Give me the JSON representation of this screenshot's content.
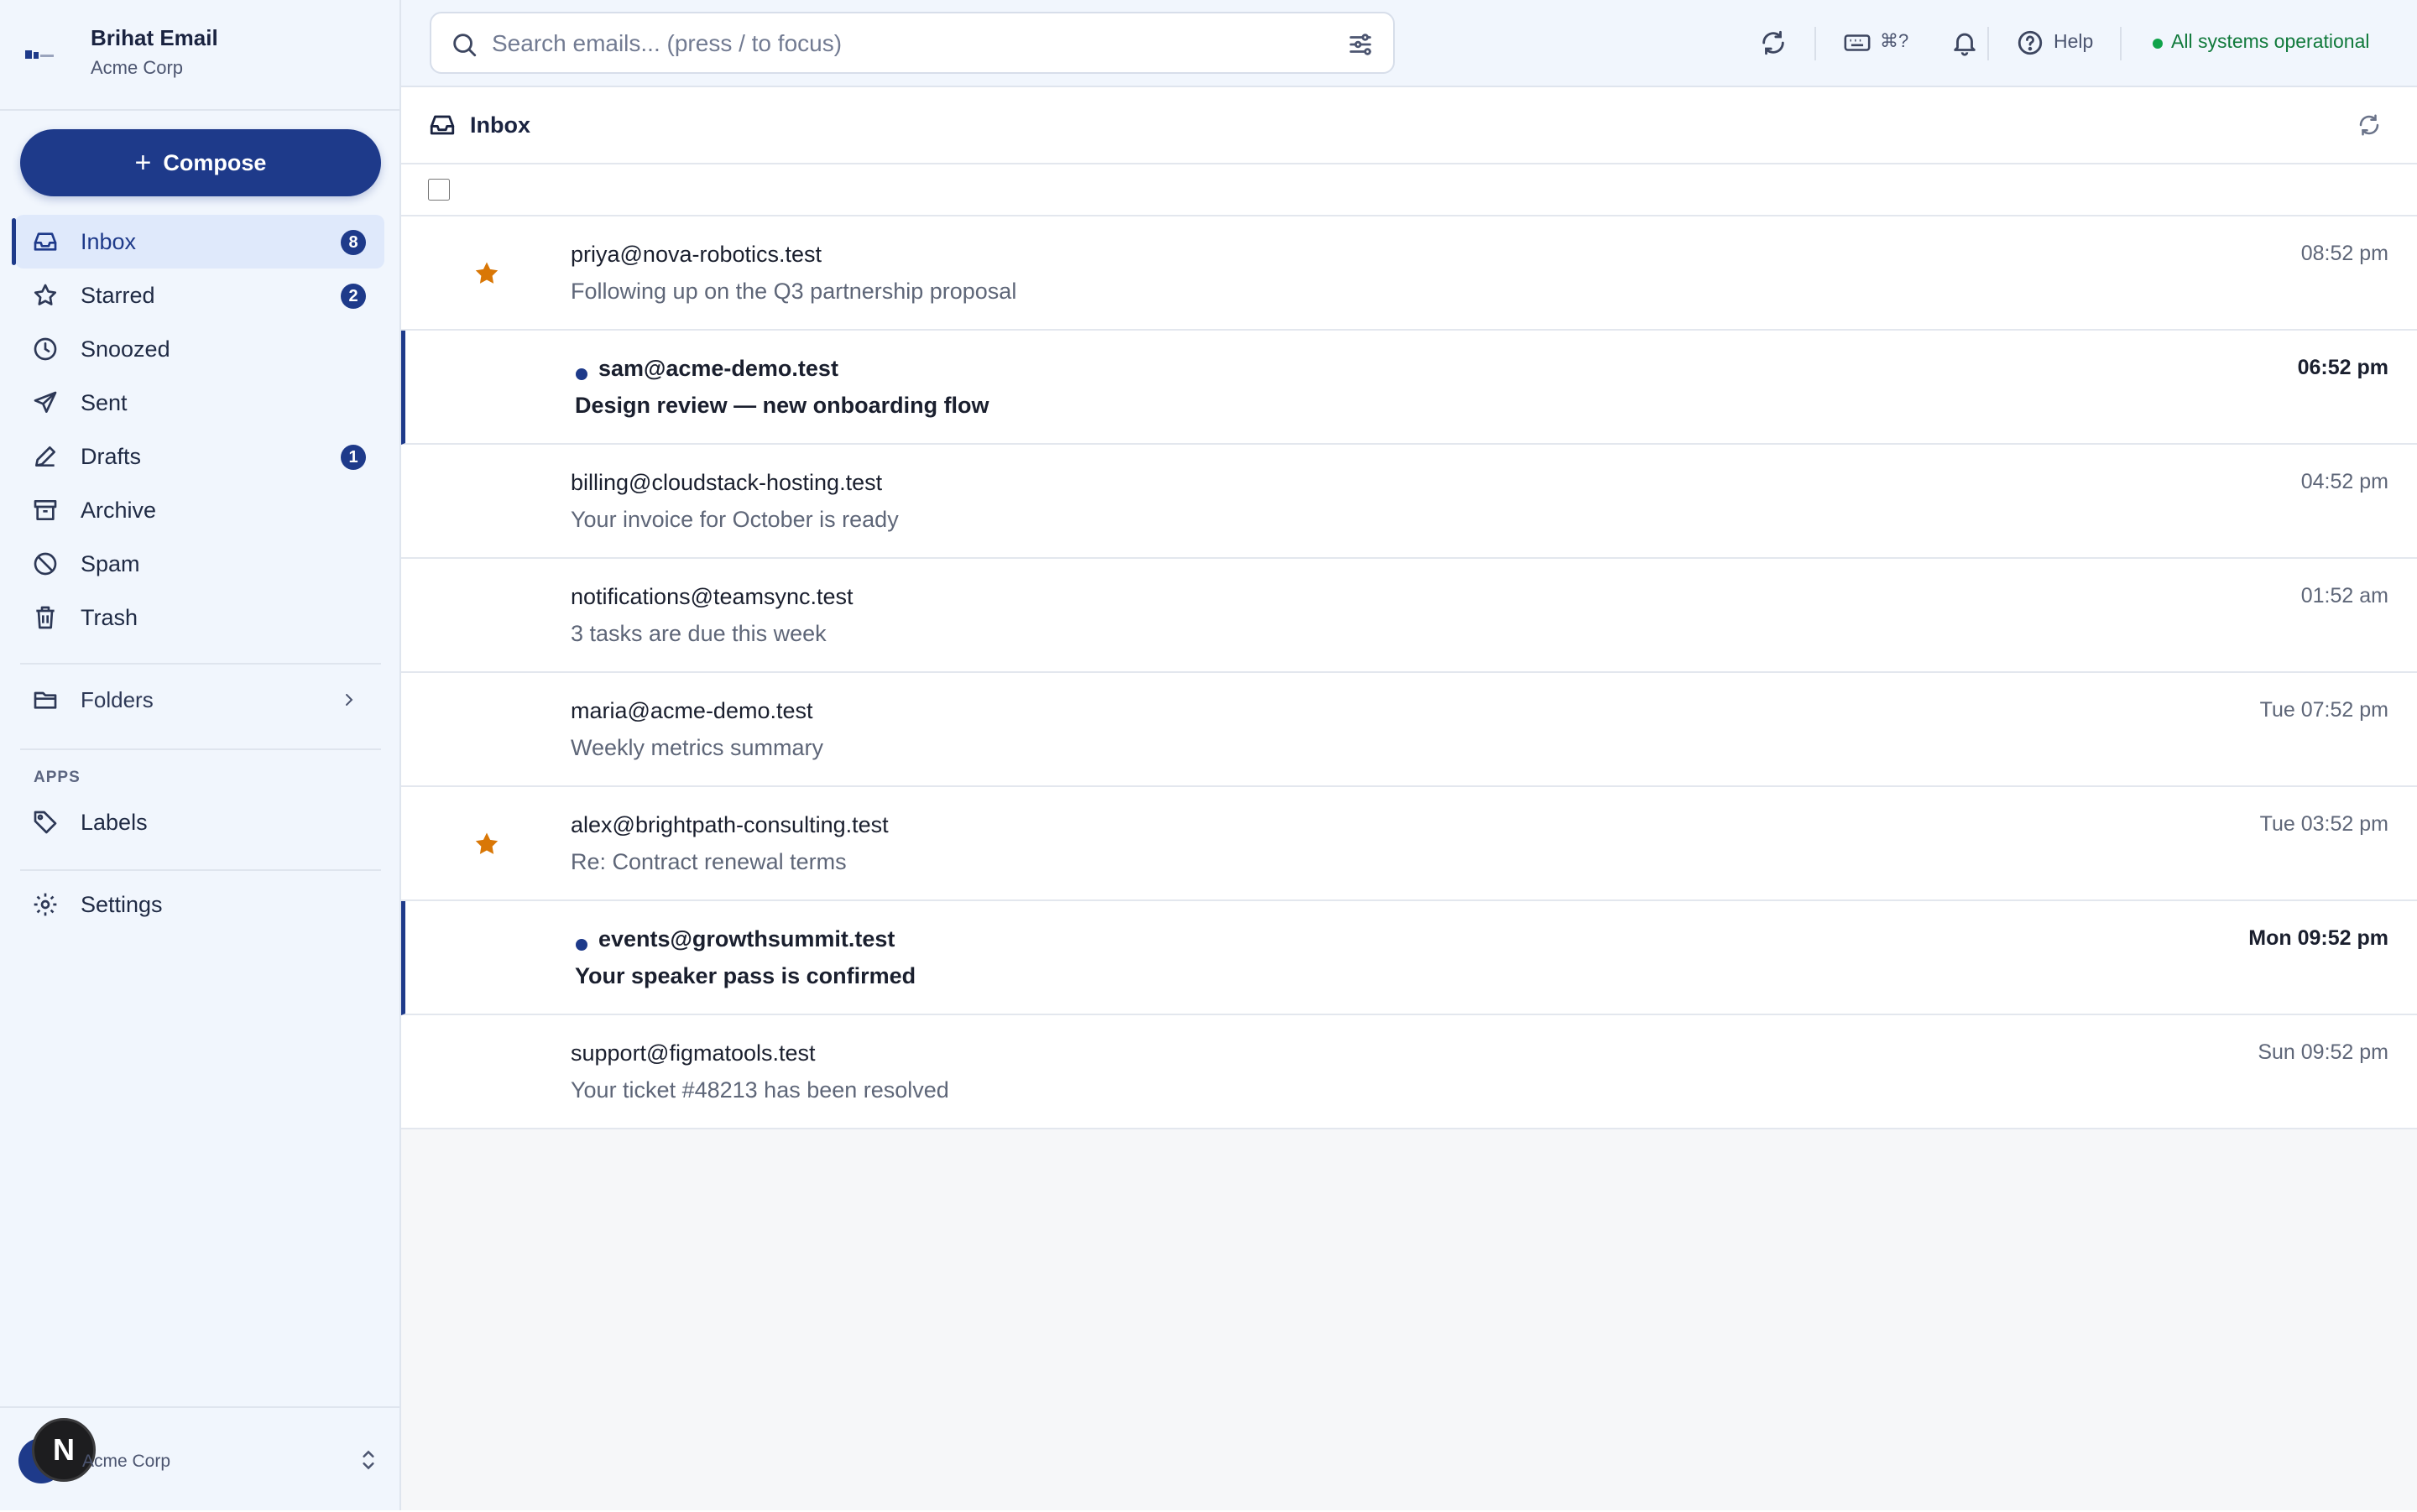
{
  "brand": {
    "title": "Brihat Email",
    "org": "Acme Corp"
  },
  "compose": {
    "label": "Compose"
  },
  "nav": [
    {
      "label": "Inbox",
      "icon": "inbox-icon",
      "badge": "8",
      "active": true
    },
    {
      "label": "Starred",
      "icon": "star-icon",
      "badge": "2"
    },
    {
      "label": "Snoozed",
      "icon": "clock-icon",
      "badge": ""
    },
    {
      "label": "Sent",
      "icon": "send-icon",
      "badge": ""
    },
    {
      "label": "Drafts",
      "icon": "pencil-icon",
      "badge": "1"
    },
    {
      "label": "Archive",
      "icon": "archive-icon",
      "badge": ""
    },
    {
      "label": "Spam",
      "icon": "ban-icon",
      "badge": ""
    },
    {
      "label": "Trash",
      "icon": "trash-icon",
      "badge": ""
    }
  ],
  "folders": {
    "label": "Folders"
  },
  "apps": {
    "section_label": "APPS",
    "labels_label": "Labels"
  },
  "settings": {
    "label": "Settings"
  },
  "footer": {
    "avatar_letter": "N",
    "org": "Acme Corp"
  },
  "search": {
    "placeholder": "Search emails... (press / to focus)",
    "value": ""
  },
  "topbar": {
    "shortcut_label": "⌘?",
    "help_label": "Help",
    "status_text": "All systems operational",
    "status_color": "#10a34a"
  },
  "inbox": {
    "title": "Inbox"
  },
  "emails": [
    {
      "from": "priya@nova-robotics.test",
      "subject": "Following up on the Q3 partnership proposal",
      "time": "08:52 pm",
      "starred": true,
      "unread": false
    },
    {
      "from": "sam@acme-demo.test",
      "subject": "Design review — new onboarding flow",
      "time": "06:52 pm",
      "starred": false,
      "unread": true
    },
    {
      "from": "billing@cloudstack-hosting.test",
      "subject": "Your invoice for October is ready",
      "time": "04:52 pm",
      "starred": false,
      "unread": false
    },
    {
      "from": "notifications@teamsync.test",
      "subject": "3 tasks are due this week",
      "time": "01:52 am",
      "starred": false,
      "unread": false
    },
    {
      "from": "maria@acme-demo.test",
      "subject": "Weekly metrics summary",
      "time": "Tue 07:52 pm",
      "starred": false,
      "unread": false
    },
    {
      "from": "alex@brightpath-consulting.test",
      "subject": "Re: Contract renewal terms",
      "time": "Tue 03:52 pm",
      "starred": true,
      "unread": false
    },
    {
      "from": "events@growthsummit.test",
      "subject": "Your speaker pass is confirmed",
      "time": "Mon 09:52 pm",
      "starred": false,
      "unread": true
    },
    {
      "from": "support@figmatools.test",
      "subject": "Your ticket #48213 has been resolved",
      "time": "Sun 09:52 pm",
      "starred": false,
      "unread": false
    }
  ],
  "colors": {
    "primary": "#1e3a8a",
    "star": "#d97706",
    "sidebar_bg": "#f1f6fd"
  }
}
